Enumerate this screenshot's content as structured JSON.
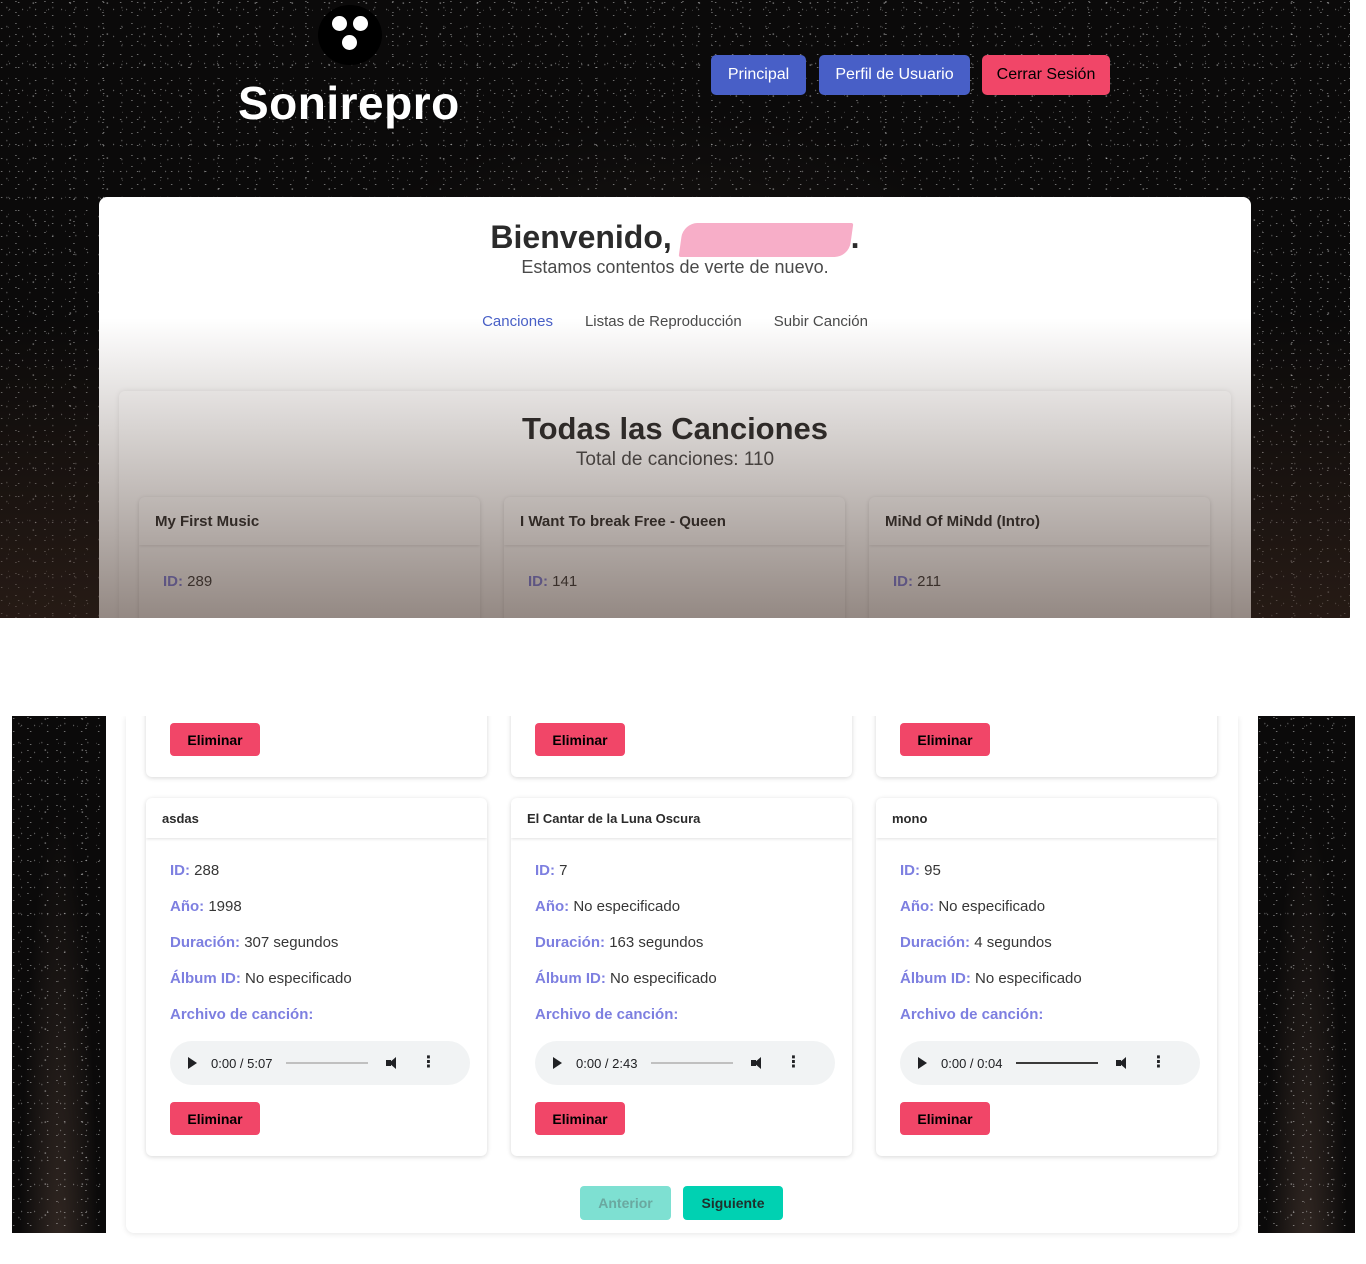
{
  "header": {
    "brand": "Sonirepro",
    "nav": {
      "home": "Principal",
      "profile": "Perfil de Usuario",
      "logout": "Cerrar Sesión"
    }
  },
  "welcome": {
    "greeting": "Bienvenido,",
    "punct": ".",
    "subtitle": "Estamos contentos de verte de nuevo."
  },
  "tabs": [
    {
      "label": "Canciones",
      "active": true
    },
    {
      "label": "Listas de Reproducción",
      "active": false
    },
    {
      "label": "Subir Canción",
      "active": false
    }
  ],
  "songs_section": {
    "title": "Todas las Canciones",
    "total": "Total de canciones: 110"
  },
  "labels": {
    "id": "ID:",
    "year": "Año:",
    "duration": "Duración:",
    "album": "Álbum ID:",
    "file": "Archivo de canción:",
    "delete": "Eliminar"
  },
  "songs_top": [
    {
      "title": "My First Music",
      "id": "289"
    },
    {
      "title": "I Want To break Free - Queen",
      "id": "141"
    },
    {
      "title": "MiNd Of MiNdd (Intro)",
      "id": "211"
    }
  ],
  "songs_bottom": [
    {
      "title": "asdas",
      "id": "288",
      "year": "1998",
      "duration": "307 segundos",
      "album": "No especificado",
      "player_time": "0:00 / 5:07",
      "progress": 0
    },
    {
      "title": "El Cantar de la Luna Oscura",
      "id": "7",
      "year": "No especificado",
      "duration": "163 segundos",
      "album": "No especificado",
      "player_time": "0:00 / 2:43",
      "progress": 0
    },
    {
      "title": "mono",
      "id": "95",
      "year": "No especificado",
      "duration": "4 segundos",
      "album": "No especificado",
      "player_time": "0:00 / 0:04",
      "progress": 1
    }
  ],
  "pagination": {
    "prev": "Anterior",
    "next": "Siguiente"
  },
  "colors": {
    "primary": "#485fc7",
    "danger": "#f14668",
    "accent": "#00d1b2",
    "label": "#7d7fe0"
  }
}
